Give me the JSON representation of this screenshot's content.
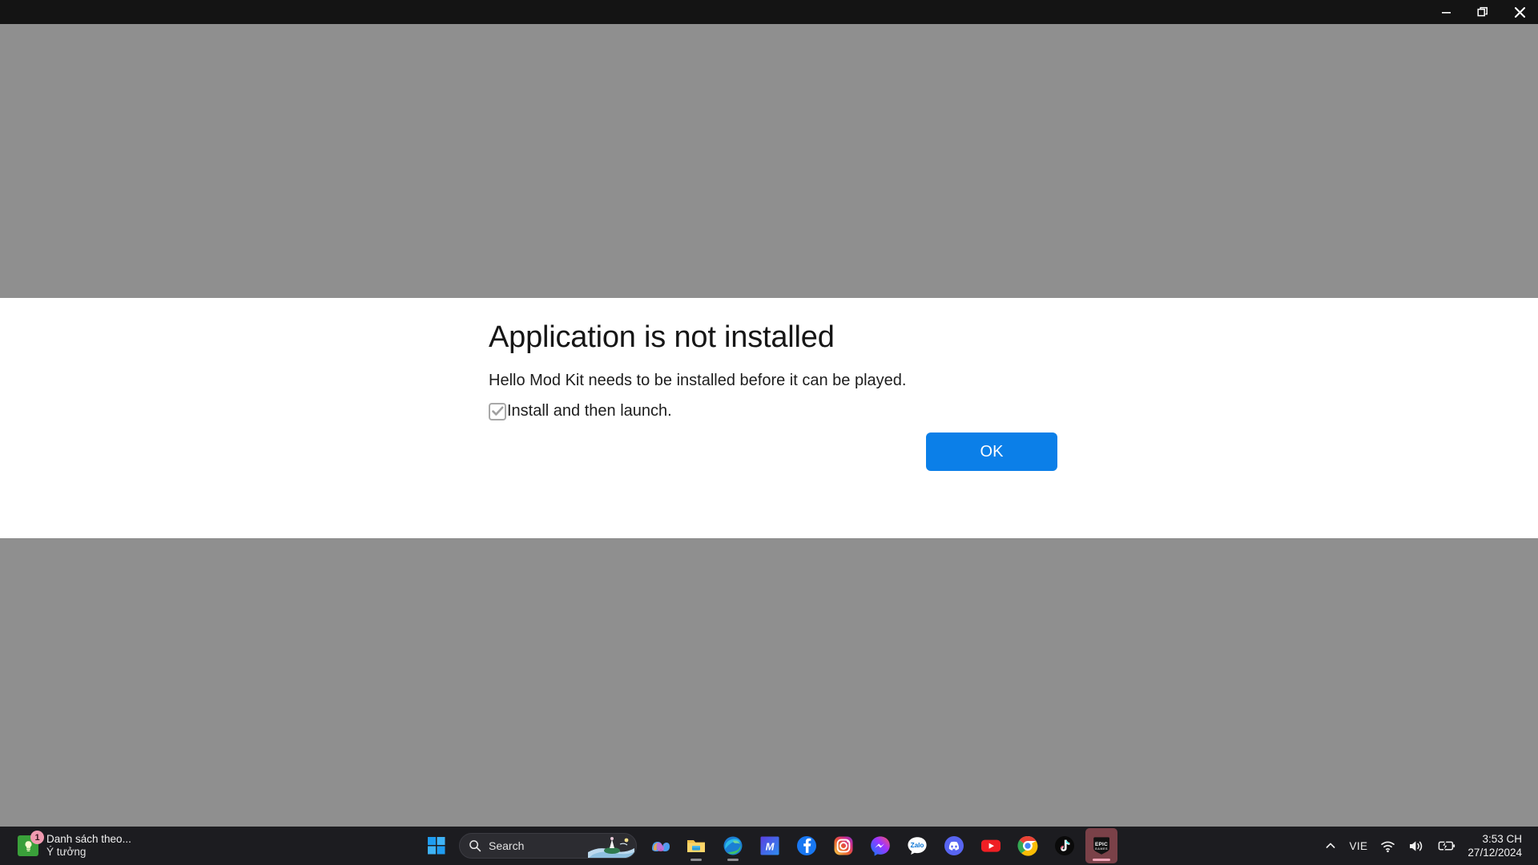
{
  "window": {
    "controls": [
      {
        "name": "minimize",
        "label": "Minimize"
      },
      {
        "name": "restore",
        "label": "Restore Down"
      },
      {
        "name": "close",
        "label": "Close"
      }
    ]
  },
  "dialog": {
    "title": "Application is not installed",
    "message": "Hello Mod Kit needs to be installed before it can be played.",
    "checkbox_label": "Install and then launch.",
    "checkbox_checked": true,
    "ok_label": "OK",
    "accent_color": "#0b7fe8",
    "background_color": "#ffffff",
    "backdrop_color": "#8f8f8f"
  },
  "taskbar": {
    "widget": {
      "line1": "Danh sách theo...",
      "line2": "Ý tưởng",
      "badge": "1",
      "icon": "notes-lightbulb-icon"
    },
    "start_label": "Start",
    "search": {
      "placeholder": "Search",
      "value": "Search",
      "icon": "search-icon"
    },
    "apps": [
      {
        "name": "copilot",
        "label": "Copilot",
        "active": false
      },
      {
        "name": "file-explorer",
        "label": "File Explorer",
        "active": true
      },
      {
        "name": "microsoft-edge",
        "label": "Microsoft Edge",
        "active": true
      },
      {
        "name": "mega",
        "label": "MEGA",
        "active": false
      },
      {
        "name": "facebook",
        "label": "Facebook",
        "active": false
      },
      {
        "name": "instagram",
        "label": "Instagram",
        "active": false
      },
      {
        "name": "messenger",
        "label": "Messenger",
        "active": false
      },
      {
        "name": "zalo",
        "label": "Zalo",
        "active": false
      },
      {
        "name": "discord",
        "label": "Discord",
        "active": false
      },
      {
        "name": "youtube",
        "label": "YouTube",
        "active": false
      },
      {
        "name": "google-chrome",
        "label": "Google Chrome",
        "active": false
      },
      {
        "name": "tiktok",
        "label": "TikTok",
        "active": true
      },
      {
        "name": "epic-games",
        "label": "Epic Games Launcher",
        "active": true,
        "focused": true
      }
    ],
    "tray": {
      "overflow_label": "Show hidden icons",
      "language": "VIE",
      "wifi_label": "Network",
      "volume_label": "Volume",
      "battery_label": "Battery charging",
      "time": "3:53 CH",
      "date": "27/12/2024"
    }
  }
}
